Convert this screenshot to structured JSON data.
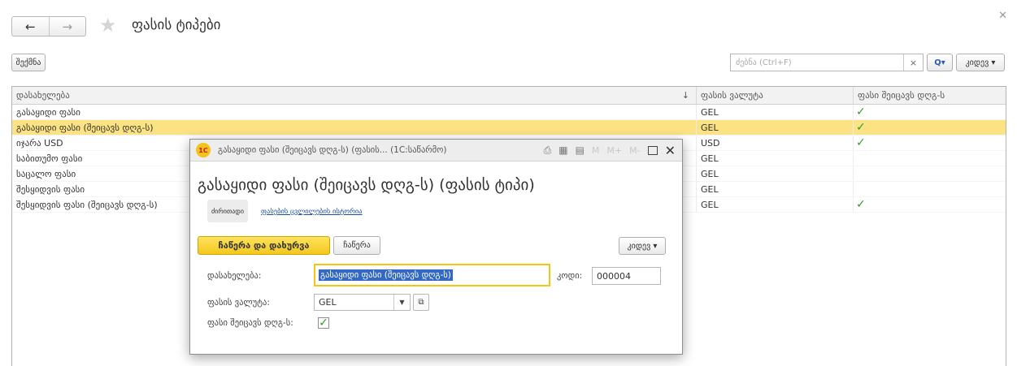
{
  "header": {
    "back_icon": "arrow-left-icon",
    "forward_icon": "arrow-right-icon",
    "star_icon": "star-icon",
    "title": "ფასის ტიპები",
    "close_icon": "close-icon"
  },
  "toolbar": {
    "create_label": "შექმნა",
    "search_placeholder": "ძებნა (Ctrl+F)",
    "clear_icon": "×",
    "search_icon": "Q▾",
    "more_label": "კიდევ ▾"
  },
  "table": {
    "columns": [
      "დასახელება",
      "ფასის ვალუტა",
      "ფასი შეიცავს დღგ-ს"
    ],
    "sort_indicator": "↓",
    "rows": [
      {
        "name": "გასაყიდი ფასი",
        "currency": "GEL",
        "vat": "✓"
      },
      {
        "name": "გასაყიდი ფასი (შეიცავს დღგ-ს)",
        "currency": "GEL",
        "vat": "✓"
      },
      {
        "name": "იჯარა USD",
        "currency": "USD",
        "vat": "✓"
      },
      {
        "name": "საბითუმო ფასი",
        "currency": "GEL",
        "vat": ""
      },
      {
        "name": "საცალო ფასი",
        "currency": "GEL",
        "vat": ""
      },
      {
        "name": "შესყიდვის ფასი",
        "currency": "GEL",
        "vat": ""
      },
      {
        "name": "შესყიდვის ფასი (შეიცავს დღგ-ს)",
        "currency": "GEL",
        "vat": "✓"
      }
    ],
    "selected_row": 1
  },
  "modal": {
    "logo": "1С",
    "window_title": "გასაყიდი ფასი (შეიცავს დღგ-ს) (ფასის...  (1С:საწარმო)",
    "titlebar_icons": [
      "printer-icon",
      "calculator-icon",
      "calendar-icon"
    ],
    "memory_buttons": [
      "M",
      "M+",
      "M-"
    ],
    "heading": "გასაყიდი ფასი (შეიცავს დღგ-ს) (ფასის ტიპი)",
    "tab_main": "ძირითადი",
    "tab_history": "ფასების ცვლილების ისტორია",
    "save_close_label": "ჩაწერა და დახურვა",
    "save_label": "ჩაწერა",
    "more_label": "კიდევ ▾",
    "fields": {
      "name_label": "დასახელება:",
      "name_value": "გასაყიდი ფასი (შეიცავს დღგ-ს)",
      "code_label": "კოდი:",
      "code_value": "000004",
      "currency_label": "ფასის ვალუტა:",
      "currency_value": "GEL",
      "vat_label": "ფასი შეიცავს დღგ-ს:",
      "vat_checked": true
    }
  },
  "colors": {
    "selected_row": "#fbe283",
    "accent_button": "#f3c81d",
    "check": "#2ba12b",
    "link": "#1a4fa0",
    "text_selection": "#3369c5"
  }
}
